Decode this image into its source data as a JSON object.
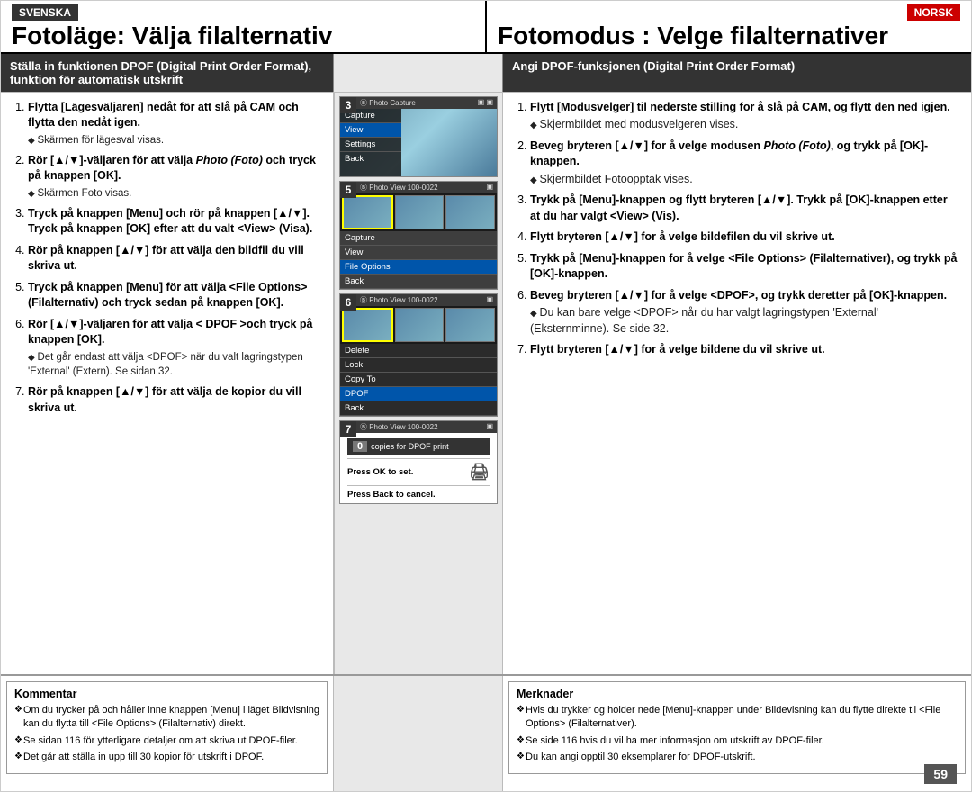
{
  "header": {
    "left_lang": "SVENSKA",
    "right_lang": "NORSK",
    "left_title": "Fotoläge: Välja filalternativ",
    "right_title": "Fotomodus : Velge filalternativer"
  },
  "left_section_header": "Ställa in funktionen DPOF (Digital Print Order Format), funktion för automatisk utskrift",
  "right_section_header": "Angi DPOF-funksjonen (Digital Print Order Format)",
  "left_steps": [
    {
      "num": 1,
      "text": "Flytta [Lägesväljaren] nedåt för att slå på CAM och flytta den nedåt igen.",
      "bullet": "Skärmen för lägesval visas."
    },
    {
      "num": 2,
      "text": "Rör [▲/▼]-väljaren för att välja Photo (Foto) och tryck på knappen [OK].",
      "italic_part": "Photo (Foto)",
      "bullet": "Skärmen Foto visas."
    },
    {
      "num": 3,
      "text": "Tryck på knappen [Menu] och rör på knappen [▲/▼].",
      "text2": "Tryck på knappen [OK] efter att du valt <View> (Visa)."
    },
    {
      "num": 4,
      "text": "Rör på knappen [▲/▼] för att välja den bildfil du vill skriva ut."
    },
    {
      "num": 5,
      "text": "Tryck på knappen [Menu] för att välja <File Options> (Filalternativ) och tryck sedan på knappen [OK]."
    },
    {
      "num": 6,
      "text": "Rör [▲/▼]-väljaren för att välja < DPOF >och tryck på knappen [OK].",
      "bullet": "Det går endast att välja <DPOF> när du valt lagringstypen 'External' (Extern). Se sidan 32."
    },
    {
      "num": 7,
      "text": "Rör på knappen [▲/▼] för att välja de kopior du vill skriva ut."
    }
  ],
  "right_steps": [
    {
      "num": 1,
      "text": "Flytt [Modusvelger] til nederste stilling for å slå på CAM, og flytt den ned igjen.",
      "bullet": "Skjermbildet med modusvelgeren vises."
    },
    {
      "num": 2,
      "text": "Beveg bryteren [▲/▼] for å velge modusen Photo (Foto), og trykk på [OK]-knappen.",
      "italic_part": "Photo (Foto)",
      "bullet": "Skjermbildet Fotoopptak vises."
    },
    {
      "num": 3,
      "text": "Trykk på [Menu]-knappen og flytt bryteren [▲/▼]. Trykk på [OK]-knappen etter at du har valgt <View> (Vis)."
    },
    {
      "num": 4,
      "text": "Flytt bryteren [▲/▼] for å velge bildefilen du vil skrive ut."
    },
    {
      "num": 5,
      "text": "Trykk på [Menu]-knappen for å velge <File Options> (Filalternativer), og trykk på [OK]-knappen."
    },
    {
      "num": 6,
      "text": "Beveg bryteren [▲/▼] for å velge <DPOF>, og trykk deretter på [OK]-knappen.",
      "bullet": "Du kan bare velge <DPOF> når du har valgt lagringstypen 'External' (Eksternminne). Se side 32."
    },
    {
      "num": 7,
      "text": "Flytt bryteren [▲/▼] for å velge bildene du vil skrive ut."
    }
  ],
  "screens": [
    {
      "step": "3",
      "topbar": "Photo Capture",
      "menu_items": [
        "Capture",
        "View",
        "Settings",
        "Back"
      ],
      "selected": "View"
    },
    {
      "step": "5",
      "topbar": "Photo View 100-0022",
      "menu_items": [
        "Capture",
        "View",
        "File Options",
        "Back"
      ],
      "selected": "File Options"
    },
    {
      "step": "6",
      "topbar": "Photo View 100-0022",
      "menu_items": [
        "Delete",
        "Lock",
        "Copy To",
        "DPOF",
        "Back"
      ],
      "selected": "DPOF"
    },
    {
      "step": "7",
      "topbar": "Photo View 100-0022",
      "copies_label": "copies for DPOF print",
      "copies_num": "0",
      "ok_text": "Press OK to set.",
      "back_text": "Press Back to cancel."
    }
  ],
  "notes_left": {
    "title": "Kommentar",
    "bullets": [
      "Om du trycker på och håller inne knappen [Menu] i läget Bildvisning kan du flytta till <File Options> (Filalternativ) direkt.",
      "Se sidan 116 för ytterligare detaljer om att skriva ut DPOF-filer.",
      "Det går att ställa in upp till 30 kopior för utskrift i DPOF."
    ]
  },
  "notes_right": {
    "title": "Merknader",
    "bullets": [
      "Hvis du trykker og holder nede [Menu]-knappen under Bildevisning kan du flytte direkte til <File Options> (Filalternativer).",
      "Se side 116 hvis du vil ha mer informasjon om utskrift av DPOF-filer.",
      "Du kan angi opptil 30 eksemplarer for DPOF-utskrift."
    ]
  },
  "page_number": "59"
}
